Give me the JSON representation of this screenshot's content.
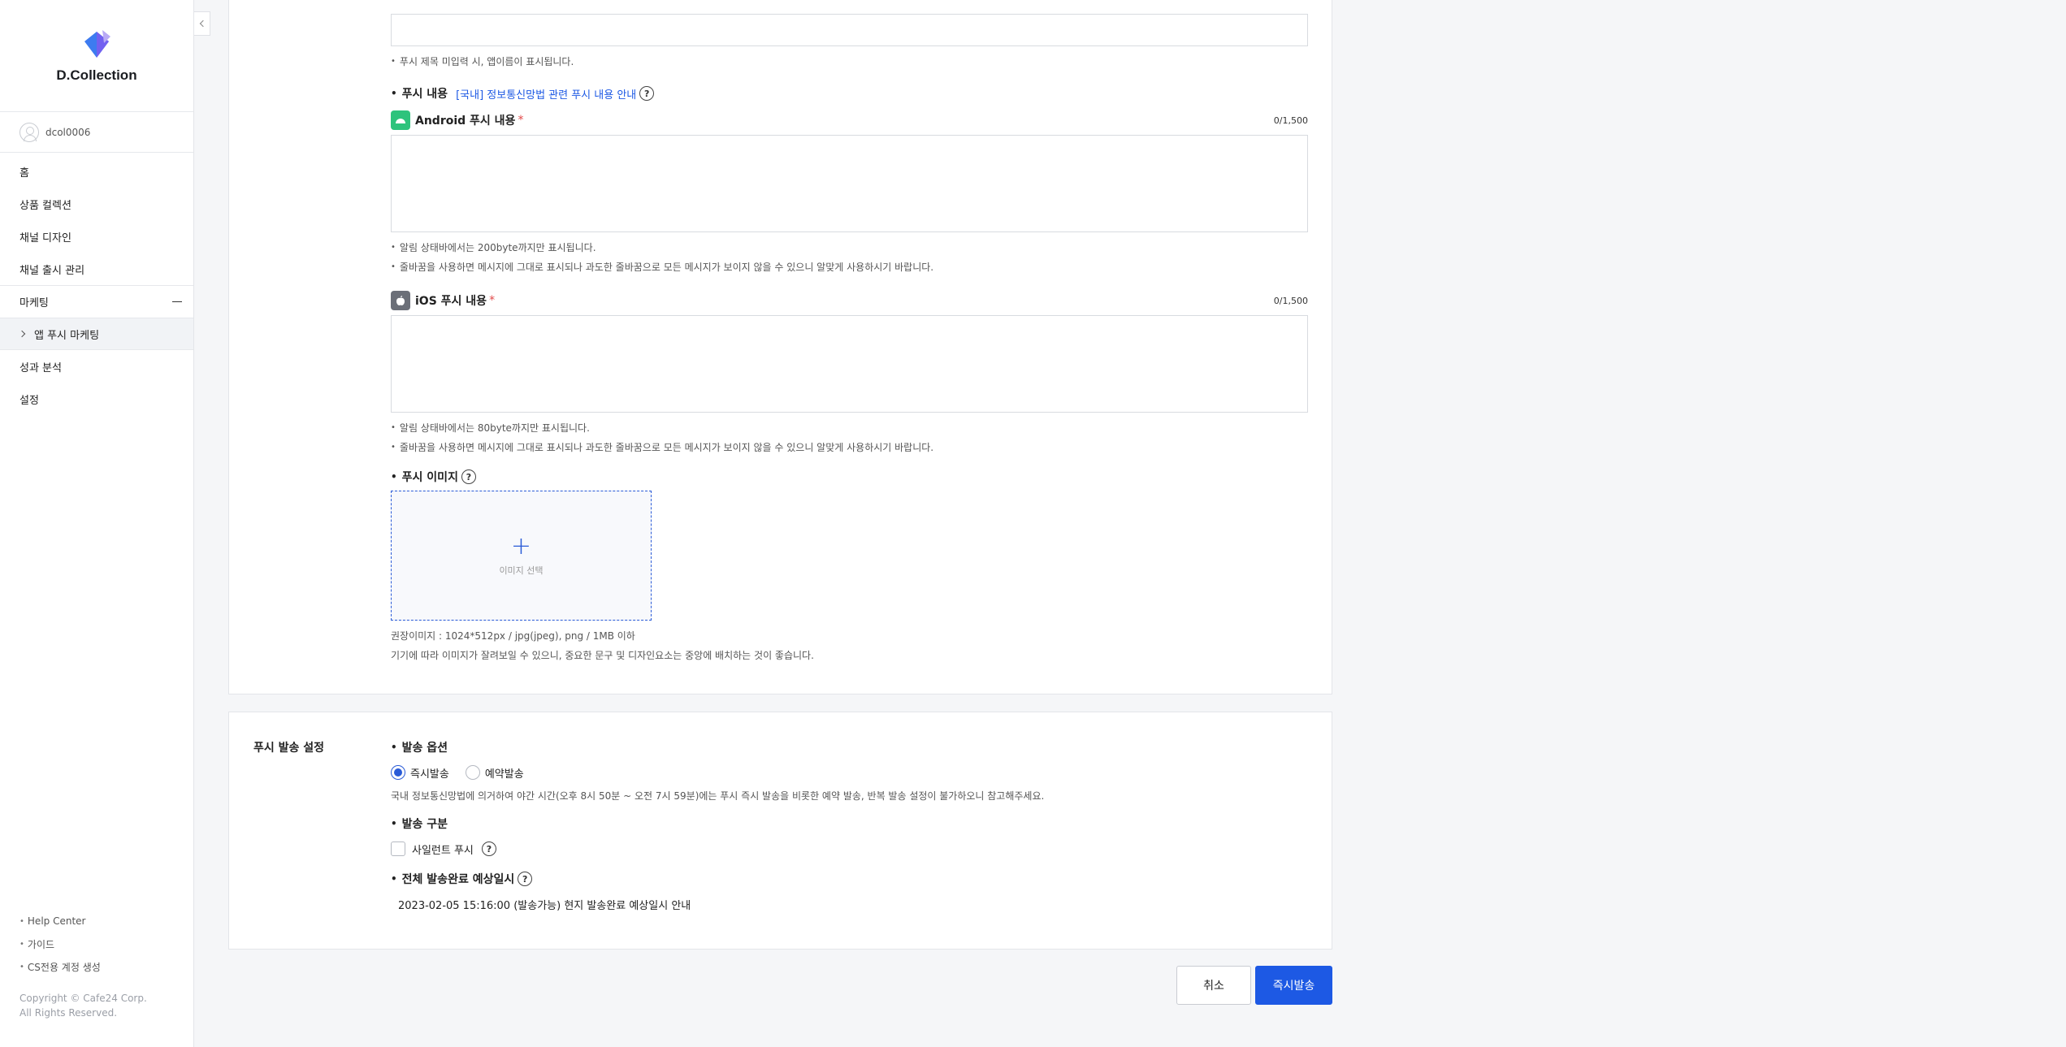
{
  "sidebar": {
    "logo_text": "D.Collection",
    "user": "dcol0006",
    "items": [
      {
        "label": "홈"
      },
      {
        "label": "상품 컬렉션"
      },
      {
        "label": "채널 디자인"
      },
      {
        "label": "채널 출시 관리"
      },
      {
        "label": "마케팅"
      },
      {
        "label": "앱 푸시 마케팅"
      },
      {
        "label": "성과 분석"
      },
      {
        "label": "설정"
      }
    ],
    "footer_links": [
      "Help Center",
      "가이드",
      "CS전용 계정 생성"
    ],
    "copyright_line1": "Copyright © Cafe24 Corp.",
    "copyright_line2": "All Rights Reserved."
  },
  "push_content": {
    "title_note": "푸시 제목 미입력 시, 앱이름이 표시됩니다.",
    "content_label": "푸시 내용",
    "content_link": "[국내] 정보통신망법 관련 푸시 내용 안내",
    "android_label": "Android 푸시 내용",
    "android_counter": "0/1,500",
    "android_notes": [
      "알림 상태바에서는 200byte까지만 표시됩니다.",
      "줄바꿈을 사용하면 메시지에 그대로 표시되나 과도한 줄바꿈으로 모든 메시지가 보이지 않을 수 있으니 알맞게 사용하시기 바랍니다."
    ],
    "ios_label": "iOS 푸시 내용",
    "ios_counter": "0/1,500",
    "ios_notes": [
      "알림 상태바에서는 80byte까지만 표시됩니다.",
      "줄바꿈을 사용하면 메시지에 그대로 표시되나 과도한 줄바꿈으로 모든 메시지가 보이지 않을 수 있으니 알맞게 사용하시기 바랍니다."
    ],
    "image_label": "푸시 이미지",
    "image_select": "이미지 선택",
    "image_note1": "권장이미지 : 1024*512px / jpg(jpeg), png / 1MB 이하",
    "image_note2": "기기에 따라 이미지가 잘려보일 수 있으니, 중요한 문구 및 디자인요소는 중앙에 배치하는 것이 좋습니다."
  },
  "send_settings": {
    "section_title": "푸시 발송 설정",
    "option_label": "발송 옵션",
    "radio_now": "즉시발송",
    "radio_scheduled": "예약발송",
    "option_note": "국내 정보통신망법에 의거하여 야간 시간(오후 8시 50분 ~ 오전 7시 59분)에는 푸시 즉시 발송을 비롯한 예약 발송, 반복 발송 설정이 불가하오니 참고해주세요.",
    "type_label": "발송 구분",
    "silent_label": "사일런트 푸시",
    "eta_label": "전체 발송완료 예상일시",
    "eta_value": "2023-02-05 15:16:00 (발송가능) 현지 발송완료 예상일시 안내"
  },
  "actions": {
    "cancel": "취소",
    "send_now": "즉시발송"
  },
  "colors": {
    "accent": "#1d59e4",
    "android": "#2ec37c",
    "ios": "#6b6f78"
  }
}
